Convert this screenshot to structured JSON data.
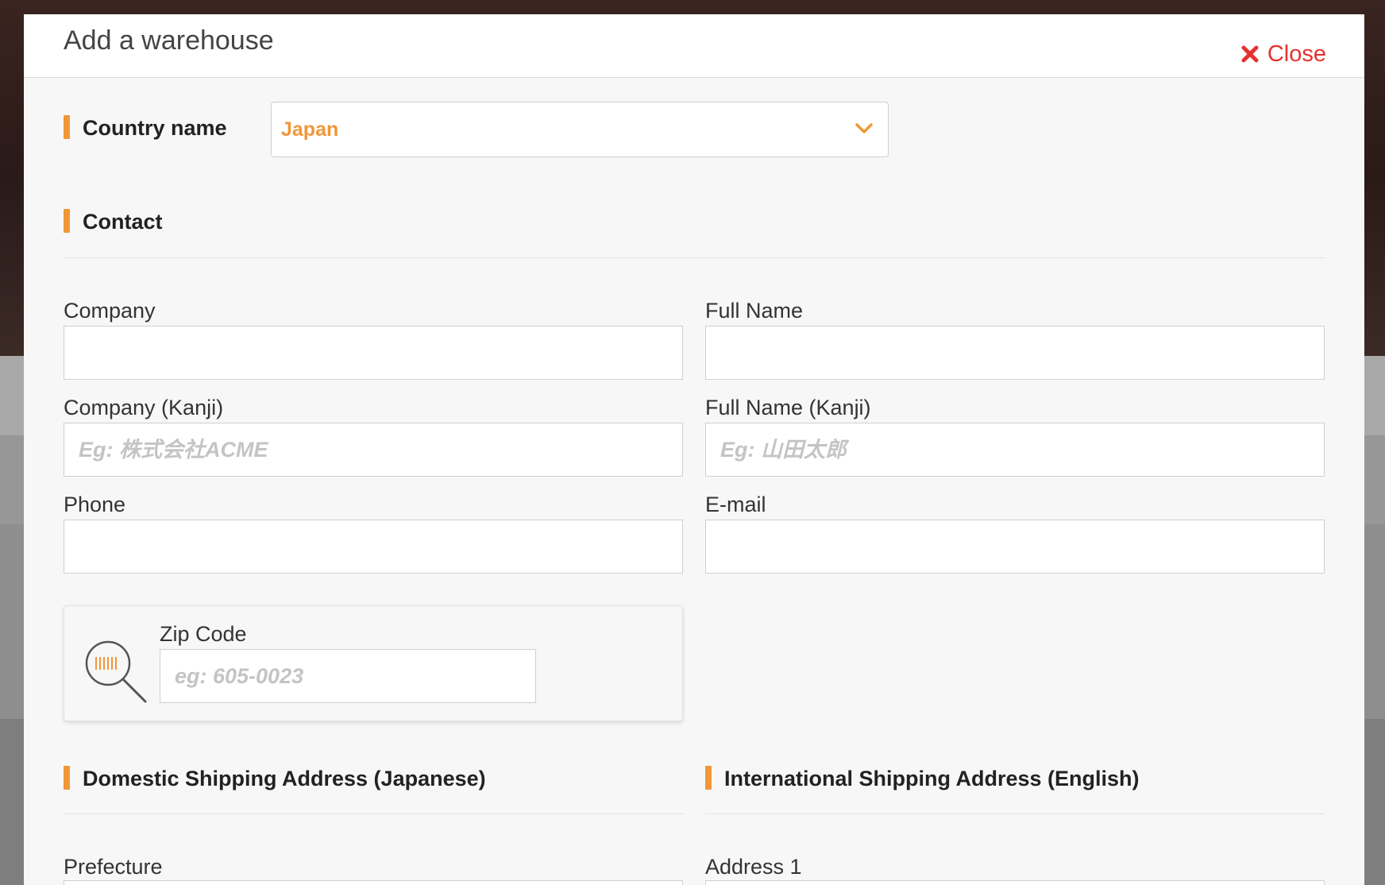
{
  "modal": {
    "title": "Add a warehouse",
    "close_label": "Close"
  },
  "country": {
    "label": "Country name",
    "selected": "Japan"
  },
  "contact": {
    "title": "Contact",
    "fields": {
      "company": {
        "label": "Company",
        "value": "",
        "placeholder": ""
      },
      "full_name": {
        "label": "Full Name",
        "value": "",
        "placeholder": ""
      },
      "company_kanji": {
        "label": "Company (Kanji)",
        "value": "",
        "placeholder": "Eg: 株式会社ACME"
      },
      "full_name_kanji": {
        "label": "Full Name (Kanji)",
        "value": "",
        "placeholder": "Eg: 山田太郎"
      },
      "phone": {
        "label": "Phone",
        "value": "",
        "placeholder": ""
      },
      "email": {
        "label": "E-mail",
        "value": "",
        "placeholder": ""
      }
    }
  },
  "zip": {
    "label": "Zip Code",
    "placeholder": "eg: 605-0023",
    "icon": "zip-search-icon"
  },
  "domestic_address": {
    "title": "Domestic Shipping Address (Japanese)",
    "first_field_label": "Prefecture"
  },
  "international_address": {
    "title": "International Shipping Address (English)",
    "first_field_label": "Address 1"
  },
  "colors": {
    "accent": "#f19738",
    "close": "#e5322d",
    "modal_bg": "#f7f7f7",
    "header_bg": "#ffffff"
  }
}
